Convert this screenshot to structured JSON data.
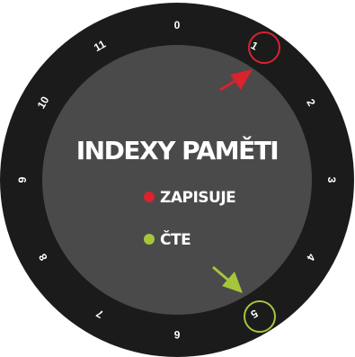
{
  "title": "INDEXY PAMĚTI",
  "legend": [
    {
      "label": "ZAPISUJE",
      "color": "#d9232d"
    },
    {
      "label": "ČTE",
      "color": "#a5c63b"
    }
  ],
  "dial": {
    "numbers": [
      "0",
      "1",
      "2",
      "3",
      "4",
      "5",
      "6",
      "7",
      "8",
      "9",
      "10",
      "11"
    ],
    "write_index": 1,
    "read_index": 5
  },
  "colors": {
    "outer_ring": "#1b1b1b",
    "inner_disc": "#4a4a4a",
    "text": "#ffffff",
    "write": "#d9232d",
    "read": "#a5c63b"
  }
}
